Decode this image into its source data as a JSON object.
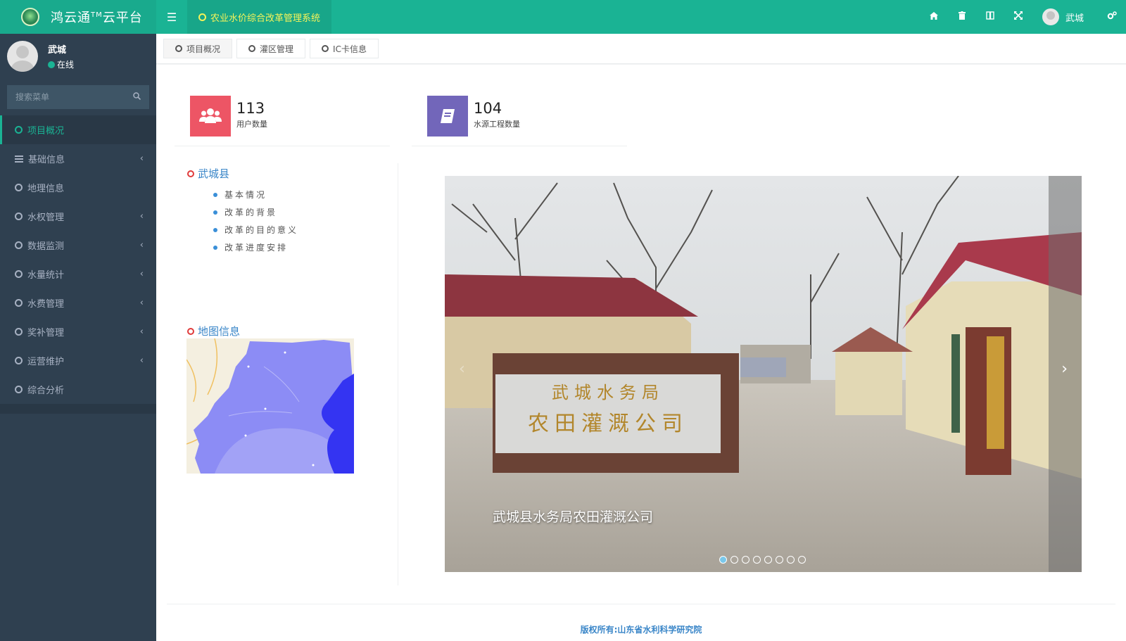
{
  "app": {
    "brand": "鸿云通",
    "brand_tm": "TM",
    "brand_suffix": "云平台",
    "system_tab": "农业水价综合改革管理系统"
  },
  "header": {
    "user_name": "武城",
    "icons": [
      "home-icon",
      "trash-icon",
      "book-icon",
      "fullscreen-icon",
      "user-avatar",
      "settings-icon"
    ]
  },
  "sidebar": {
    "profile": {
      "name": "武城",
      "status": "在线"
    },
    "search_placeholder": "搜索菜单",
    "items": [
      {
        "label": "项目概况",
        "active": true,
        "has_submenu": false
      },
      {
        "label": "基础信息",
        "active": false,
        "has_submenu": true
      },
      {
        "label": "地理信息",
        "active": false,
        "has_submenu": false
      },
      {
        "label": "水权管理",
        "active": false,
        "has_submenu": true
      },
      {
        "label": "数据监测",
        "active": false,
        "has_submenu": true
      },
      {
        "label": "水量统计",
        "active": false,
        "has_submenu": true
      },
      {
        "label": "水费管理",
        "active": false,
        "has_submenu": true
      },
      {
        "label": "奖补管理",
        "active": false,
        "has_submenu": true
      },
      {
        "label": "运营维护",
        "active": false,
        "has_submenu": true
      },
      {
        "label": "综合分析",
        "active": false,
        "has_submenu": false
      }
    ]
  },
  "tabs": [
    {
      "label": "项目概况",
      "active": true
    },
    {
      "label": "灌区管理",
      "active": false
    },
    {
      "label": "IC卡信息",
      "active": false
    }
  ],
  "stats": [
    {
      "value": "113",
      "label": "用户数量",
      "color": "#ed5565",
      "icon": "users-icon"
    },
    {
      "value": "104",
      "label": "水源工程数量",
      "color": "#7266ba",
      "icon": "book-icon"
    }
  ],
  "county": {
    "title": "武城县",
    "items": [
      "基本情况",
      "改革的背景",
      "改革的目的意义",
      "改革进度安排"
    ]
  },
  "map_section": {
    "title": "地图信息"
  },
  "carousel": {
    "caption": "武城县水务局农田灌溉公司",
    "sign_line1": "武城水务局",
    "sign_line2": "农田灌溉公司",
    "slide_count": 8,
    "active_index": 0
  },
  "footer": {
    "text": "版权所有:山东省水利科学研究院"
  },
  "colors": {
    "primary": "#1ab394",
    "sidebar": "#2f4050",
    "highlight": "#f3f35a"
  }
}
